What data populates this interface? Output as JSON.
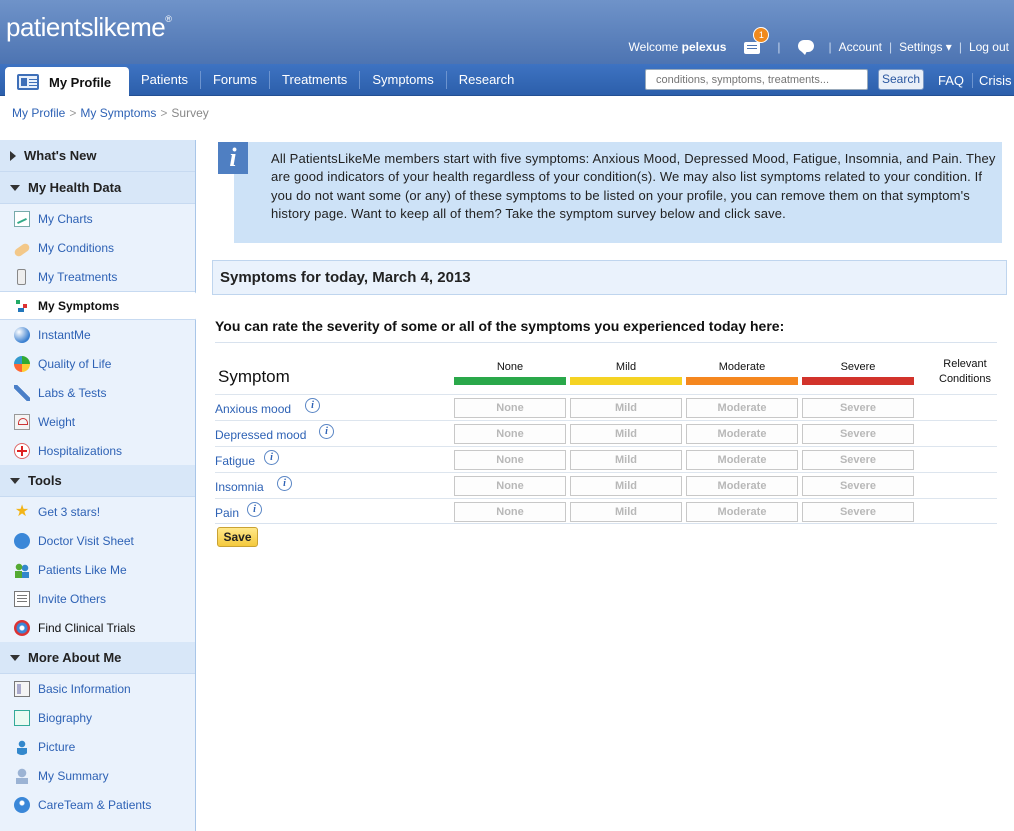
{
  "header": {
    "logo": "patientslikeme",
    "logo_mark": "®",
    "welcome_prefix": "Welcome",
    "username": "pelexus",
    "notification_count": "1",
    "links": [
      "Account",
      "Settings ▾",
      "Log out"
    ]
  },
  "nav": {
    "active_tab": "My Profile",
    "tabs": [
      "Patients",
      "Forums",
      "Treatments",
      "Symptoms",
      "Research"
    ],
    "search_placeholder": "conditions, symptoms, treatments...",
    "search_button": "Search",
    "right_links": [
      "FAQ",
      "Crisis"
    ]
  },
  "breadcrumb": {
    "items": [
      "My Profile",
      "My Symptoms"
    ],
    "current": "Survey",
    "separator": ">"
  },
  "sidebar": {
    "sections": [
      {
        "title": "What's New",
        "expanded": false,
        "items": []
      },
      {
        "title": "My Health Data",
        "expanded": true,
        "items": [
          {
            "label": "My Charts",
            "icon": "chart-icon"
          },
          {
            "label": "My Conditions",
            "icon": "bandage-icon"
          },
          {
            "label": "My Treatments",
            "icon": "pill-bottle-icon"
          },
          {
            "label": "My Symptoms",
            "icon": "symptoms-icon",
            "active": true
          },
          {
            "label": "InstantMe",
            "icon": "instantme-icon"
          },
          {
            "label": "Quality of Life",
            "icon": "quality-of-life-icon"
          },
          {
            "label": "Labs & Tests",
            "icon": "lab-icon"
          },
          {
            "label": "Weight",
            "icon": "scale-icon"
          },
          {
            "label": "Hospitalizations",
            "icon": "red-cross-icon"
          }
        ]
      },
      {
        "title": "Tools",
        "expanded": true,
        "items": [
          {
            "label": "Get 3 stars!",
            "icon": "star-icon"
          },
          {
            "label": "Doctor Visit Sheet",
            "icon": "doctor-icon"
          },
          {
            "label": "Patients Like Me",
            "icon": "people-icon"
          },
          {
            "label": "Invite Others",
            "icon": "invite-icon"
          },
          {
            "label": "Find Clinical Trials",
            "icon": "clinical-trials-icon"
          }
        ]
      },
      {
        "title": "More About Me",
        "expanded": true,
        "items": [
          {
            "label": "Basic Information",
            "icon": "info-book-icon"
          },
          {
            "label": "Biography",
            "icon": "biography-icon"
          },
          {
            "label": "Picture",
            "icon": "picture-icon"
          },
          {
            "label": "My Summary",
            "icon": "summary-icon"
          },
          {
            "label": "CareTeam & Patients",
            "icon": "careteam-icon"
          }
        ]
      }
    ]
  },
  "info": {
    "icon_glyph": "i",
    "text": "All PatientsLikeMe members start with five symptoms: Anxious Mood, Depressed Mood, Fatigue, Insomnia, and Pain. They are good indicators of your health regardless of your condition(s). We may also list symptoms related to your condition. If you do not want some (or any) of these symptoms to be listed on your profile, you can remove them on that symptom's history page. Want to keep all of them? Take the symptom survey below and click save."
  },
  "survey": {
    "title": "Symptoms for today, March 4, 2013",
    "instruction": "You can rate the severity of some or all of the symptoms you experienced today here:",
    "symptom_header": "Symptom",
    "severity_levels": [
      {
        "label": "None",
        "color": "#2aa84a"
      },
      {
        "label": "Mild",
        "color": "#f5d323"
      },
      {
        "label": "Moderate",
        "color": "#f5871f"
      },
      {
        "label": "Severe",
        "color": "#d2332b"
      }
    ],
    "relevant_header": "Relevant Conditions",
    "symptoms": [
      "Anxious mood",
      "Depressed mood",
      "Fatigue",
      "Insomnia",
      "Pain"
    ],
    "save_label": "Save"
  }
}
